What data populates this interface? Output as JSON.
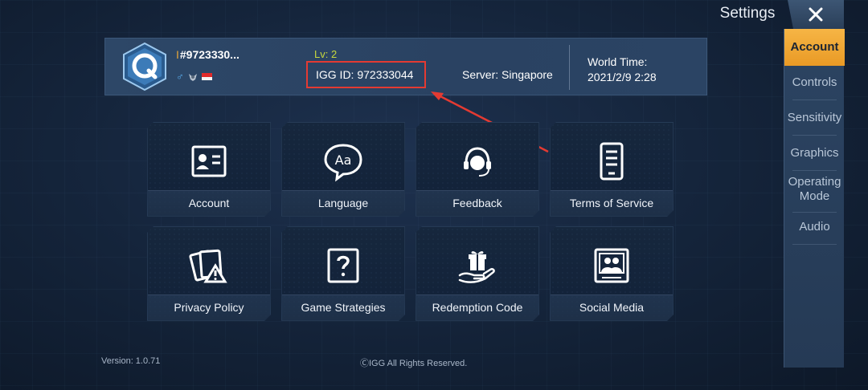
{
  "header": {
    "title": "Settings",
    "close_icon": "close-icon"
  },
  "profile": {
    "username_prefix": "I",
    "username": "#9723330...",
    "level": "Lv: 2",
    "igg_id": "IGG ID: 972333044",
    "server": "Server: Singapore",
    "world_time_label": "World Time:",
    "world_time": "2021/2/9 2:28",
    "gender_icon": "♂"
  },
  "tiles": [
    {
      "label": "Account",
      "icon": "id-card-icon"
    },
    {
      "label": "Language",
      "icon": "language-bubble-icon"
    },
    {
      "label": "Feedback",
      "icon": "headset-icon"
    },
    {
      "label": "Terms of Service",
      "icon": "document-icon"
    },
    {
      "label": "Privacy Policy",
      "icon": "privacy-warning-icon"
    },
    {
      "label": "Game Strategies",
      "icon": "question-box-icon"
    },
    {
      "label": "Redemption Code",
      "icon": "gift-hand-icon"
    },
    {
      "label": "Social Media",
      "icon": "community-icon"
    }
  ],
  "footer": {
    "version": "Version: 1.0.71",
    "copyright": "ⒸIGG All Rights Reserved."
  },
  "sidebar": {
    "items": [
      {
        "label": "Account",
        "active": true
      },
      {
        "label": "Controls"
      },
      {
        "label": "Sensitivity"
      },
      {
        "label": "Graphics"
      },
      {
        "label": "Operating\nMode"
      },
      {
        "label": "Audio"
      }
    ]
  },
  "colors": {
    "accent": "#f0a732",
    "highlight_box": "#e43a32",
    "level_text": "#c7d83e"
  }
}
